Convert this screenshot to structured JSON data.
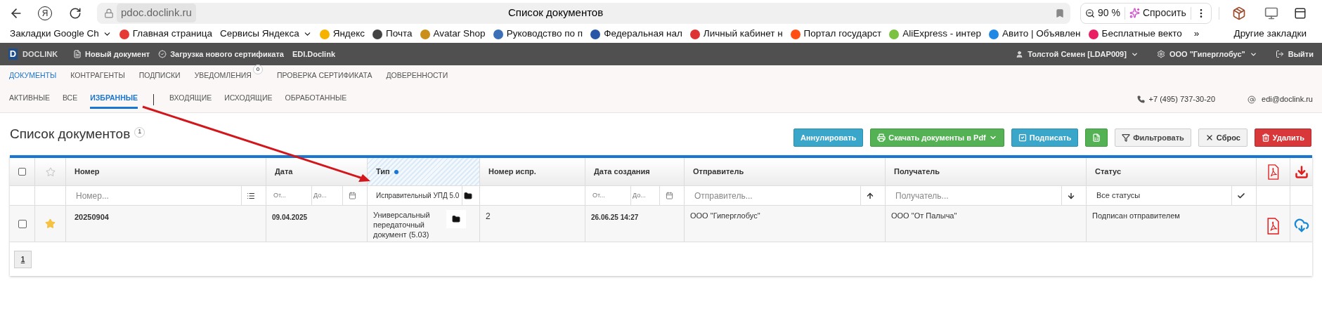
{
  "browser": {
    "home_label": "Я",
    "url": "pdoc.doclink.ru",
    "title": "Список документов",
    "zoom": "90 %",
    "ask_label": "Спросить",
    "bookmarks": [
      {
        "label": "Закладки Google Ch",
        "kind": "folder"
      },
      {
        "label": "Главная страница",
        "kind": "link"
      },
      {
        "label": "Сервисы Яндекса",
        "kind": "folder"
      },
      {
        "label": "Яндекс",
        "kind": "link"
      },
      {
        "label": "Почта",
        "kind": "link"
      },
      {
        "label": "Avatar Shop",
        "kind": "link"
      },
      {
        "label": "Руководство по п",
        "kind": "link"
      },
      {
        "label": "Федеральная нал",
        "kind": "link"
      },
      {
        "label": "Личный кабинет н",
        "kind": "link"
      },
      {
        "label": "Портал государст",
        "kind": "link"
      },
      {
        "label": "AliExpress - интер",
        "kind": "link"
      },
      {
        "label": "Авито | Объявлен",
        "kind": "link"
      },
      {
        "label": "Бесплатные векто",
        "kind": "link"
      }
    ],
    "more": "»",
    "other_bookmarks": "Другие закладки"
  },
  "app_bar": {
    "logo_letter": "D",
    "logo_text": "DOCLINK",
    "actions": [
      "Новый документ",
      "Загрузка нового сертификата",
      "EDI.Doclink"
    ],
    "user": "Толстой Семен [LDAP009]",
    "org": "ООО \"Гиперглобус\"",
    "logout": "Выйти"
  },
  "nav_tabs": [
    {
      "label": "ДОКУМЕНТЫ",
      "selected": true
    },
    {
      "label": "КОНТРАГЕНТЫ",
      "selected": false
    },
    {
      "label": "ПОДПИСКИ",
      "selected": false
    },
    {
      "label": "УВЕДОМЛЕНИЯ",
      "selected": false,
      "badge": "0"
    },
    {
      "label": "ПРОВЕРКА СЕРТИФИКАТА",
      "selected": false
    },
    {
      "label": "ДОВЕРЕННОСТИ",
      "selected": false
    }
  ],
  "sub_tabs": [
    {
      "label": "АКТИВНЫЕ",
      "selected": false
    },
    {
      "label": "ВСЕ",
      "selected": false
    },
    {
      "label": "ИЗБРАННЫЕ",
      "selected": true
    },
    {
      "label": "ВХОДЯЩИЕ",
      "selected": false
    },
    {
      "label": "ИСХОДЯЩИЕ",
      "selected": false
    },
    {
      "label": "ОБРАБОТАННЫЕ",
      "selected": false
    }
  ],
  "contacts": {
    "phone": "+7 (495) 737-30-20",
    "email": "edi@doclink.ru"
  },
  "page": {
    "title": "Список документов",
    "count": "1"
  },
  "buttons": [
    {
      "kind": "cancel",
      "label": "Аннулировать"
    },
    {
      "kind": "download",
      "label": "Скачать документы в Pdf"
    },
    {
      "kind": "sign",
      "label": "Подписать"
    },
    {
      "kind": "excel"
    },
    {
      "kind": "filter",
      "label": "Фильтровать"
    },
    {
      "kind": "reset",
      "label": "Сброс"
    },
    {
      "kind": "delete",
      "label": "Удалить"
    }
  ],
  "table": {
    "select_all_checked": false,
    "columns": [
      {
        "label": "Номер",
        "sorted": false
      },
      {
        "label": "Дата",
        "sorted": false
      },
      {
        "label": "Тип",
        "sorted": true
      },
      {
        "label": "Номер испр.",
        "sorted": false
      },
      {
        "label": "Дата создания",
        "sorted": false
      },
      {
        "label": "Отправитель",
        "sorted": false
      },
      {
        "label": "Получатель",
        "sorted": false
      },
      {
        "label": "Статус",
        "sorted": false
      }
    ],
    "filters": {
      "number": {
        "placeholder": "Номер..."
      },
      "date": {
        "from": "От...",
        "to": "До..."
      },
      "type": {
        "value": "Исправительный УПД 5.0"
      },
      "created": {
        "from": "От...",
        "to": "До..."
      },
      "sender": {
        "placeholder": "Отправитель..."
      },
      "receiver": {
        "placeholder": "Получатель..."
      },
      "status": {
        "value": "Все статусы"
      }
    },
    "rows": [
      {
        "checked": false,
        "favorite": true,
        "number": "20250904",
        "date": "09.04.2025",
        "type": "Универсальный передаточный документ (5.03)",
        "correction": "2",
        "created": "26.06.25 14:27",
        "sender": "ООО \"Гиперглобус\"",
        "receiver": "ООО \"От Палыча\"",
        "status": "Подписан отправителем"
      }
    ]
  },
  "pagination": [
    {
      "label": "1",
      "selected": true
    }
  ]
}
